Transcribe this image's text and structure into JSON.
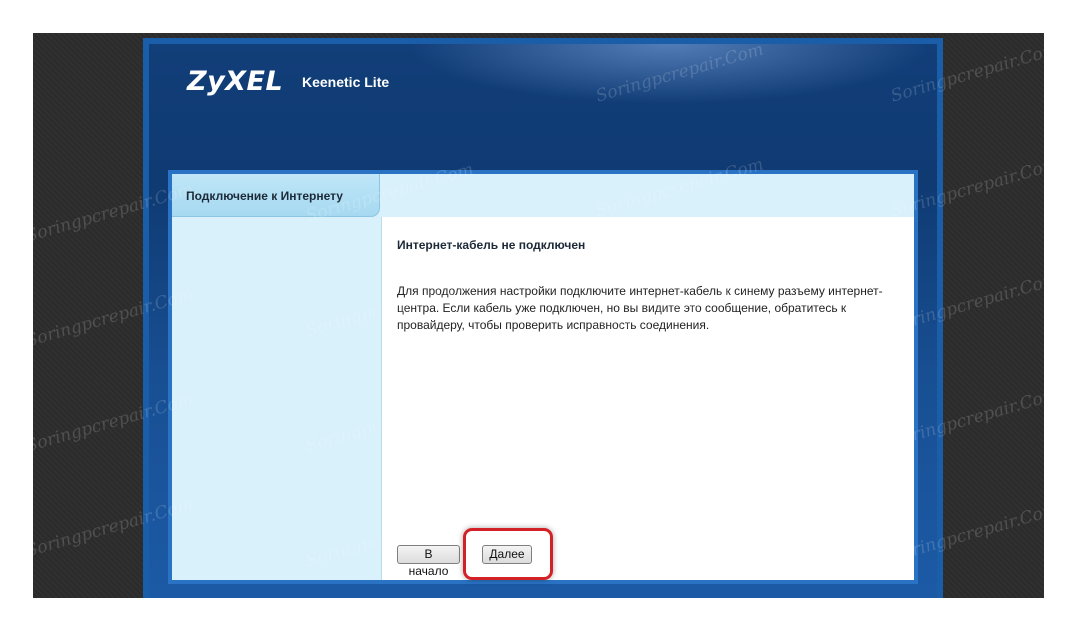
{
  "header": {
    "brand": "ZyXEL",
    "product": "Keenetic Lite"
  },
  "sidebar": {
    "tab_label": "Подключение к Интернету"
  },
  "main": {
    "title": "Интернет-кабель не подключен",
    "message": "Для продолжения настройки подключите интернет-кабель к синему разъему интернет-центра. Если кабель уже подключен, но вы видите это сообщение, обратитесь к провайдеру, чтобы проверить исправность соединения."
  },
  "buttons": {
    "back_label": "В начало",
    "next_label": "Далее"
  },
  "watermark": {
    "text": "Soringpcrepair.Com"
  }
}
